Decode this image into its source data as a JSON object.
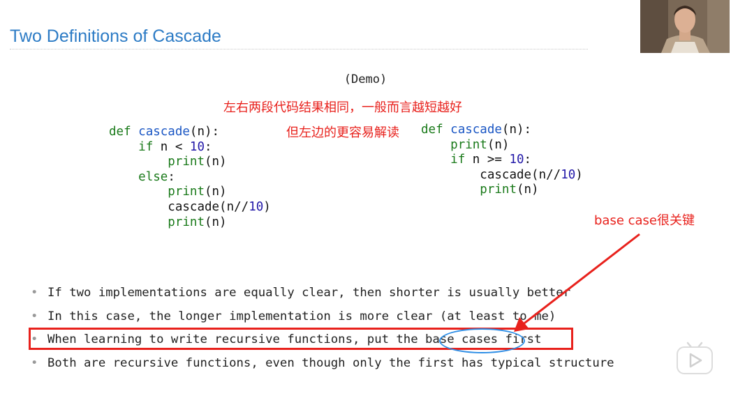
{
  "slide": {
    "title": "Two Definitions of Cascade",
    "demo_label": "(Demo)"
  },
  "notes": {
    "note1": "左右两段代码结果相同，一般而言越短越好",
    "note2": "但左边的更容易解读",
    "note3": "base case很关键"
  },
  "code_left": {
    "line1": {
      "kw": "def",
      "fn": "cascade",
      "rest": "(n):"
    },
    "line2": {
      "kw": "if",
      "rest": " n < ",
      "num": "10",
      "tail": ":"
    },
    "line3": {
      "bi": "print",
      "rest": "(n)"
    },
    "line4": {
      "kw": "else",
      "rest": ":"
    },
    "line5": {
      "bi": "print",
      "rest": "(n)"
    },
    "line6": {
      "pre": "cascade(n//",
      "num": "10",
      "rest": ")"
    },
    "line7": {
      "bi": "print",
      "rest": "(n)"
    }
  },
  "code_right": {
    "line1": {
      "kw": "def",
      "fn": "cascade",
      "rest": "(n):"
    },
    "line2": {
      "bi": "print",
      "rest": "(n)"
    },
    "line3": {
      "kw": "if",
      "rest": " n >= ",
      "num": "10",
      "tail": ":"
    },
    "line4": {
      "pre": "cascade(n//",
      "num": "10",
      "rest": ")"
    },
    "line5": {
      "bi": "print",
      "rest": "(n)"
    }
  },
  "bullets": [
    "If two implementations are equally clear, then shorter is usually better",
    "In this case, the longer implementation is more clear (at least to me)",
    "When learning to write recursive functions, put the base cases first",
    "Both are recursive functions, even though only the first has typical structure"
  ],
  "bullet_marker": "•",
  "colors": {
    "title": "#2c7bc5",
    "annotation_red": "#e8211c",
    "oval_blue": "#2d8ee6",
    "keyword_green": "#1a7a1a",
    "function_blue": "#1a56c4",
    "number_purple": "#2218a8"
  },
  "icons": {
    "webcam": "presenter-webcam",
    "player": "play-button-icon"
  }
}
